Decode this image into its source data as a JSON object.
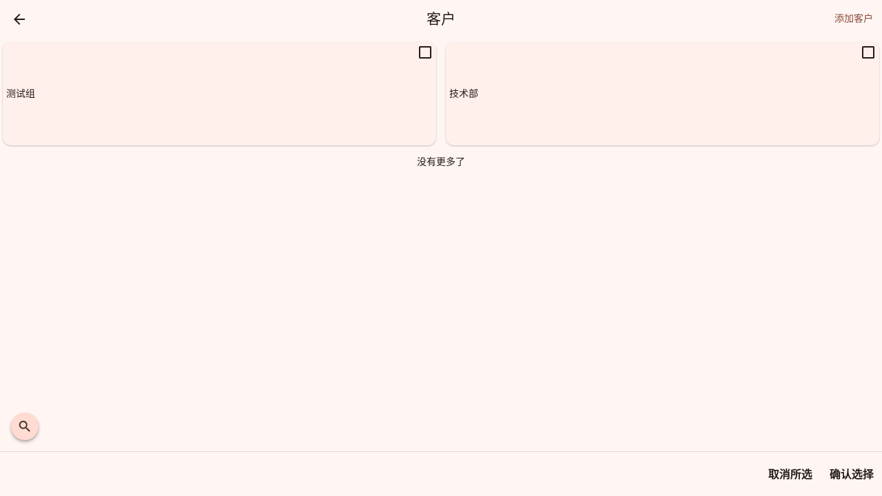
{
  "appbar": {
    "title": "客户",
    "add_label": "添加客户"
  },
  "cards": [
    {
      "label": "测试组",
      "checked": false
    },
    {
      "label": "技术部",
      "checked": false
    }
  ],
  "list_end_text": "没有更多了",
  "bottom_bar": {
    "cancel_label": "取消所选",
    "confirm_label": "确认选择"
  },
  "icons": {
    "back": "arrow-back-icon",
    "search": "search-icon",
    "checkbox": "checkbox-outline-icon"
  },
  "colors": {
    "background": "#fff6f4",
    "card": "#fff0ec",
    "accent_text": "#8b4a3a",
    "fab": "#ffdbd1"
  }
}
